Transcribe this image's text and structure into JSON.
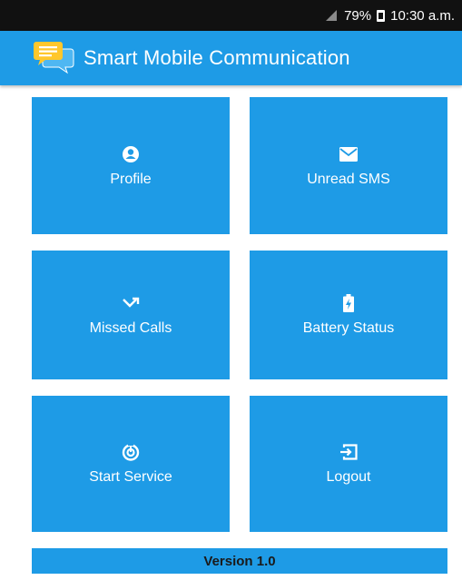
{
  "status_bar": {
    "battery_level": "79%",
    "time": "10:30 a.m."
  },
  "app_bar": {
    "title": "Smart Mobile Communication",
    "logo_icon": "chat-bubbles-icon"
  },
  "tiles": [
    {
      "label": "Profile",
      "icon": "profile-icon"
    },
    {
      "label": "Unread SMS",
      "icon": "envelope-icon"
    },
    {
      "label": "Missed Calls",
      "icon": "missed-call-icon"
    },
    {
      "label": "Battery Status",
      "icon": "battery-charging-icon"
    },
    {
      "label": "Start Service",
      "icon": "service-power-icon"
    },
    {
      "label": "Logout",
      "icon": "logout-icon"
    }
  ],
  "footer": {
    "version": "Version 1.0"
  },
  "colors": {
    "primary": "#1e9be6",
    "status_bar": "#111111",
    "tile_text": "#ffffff"
  }
}
